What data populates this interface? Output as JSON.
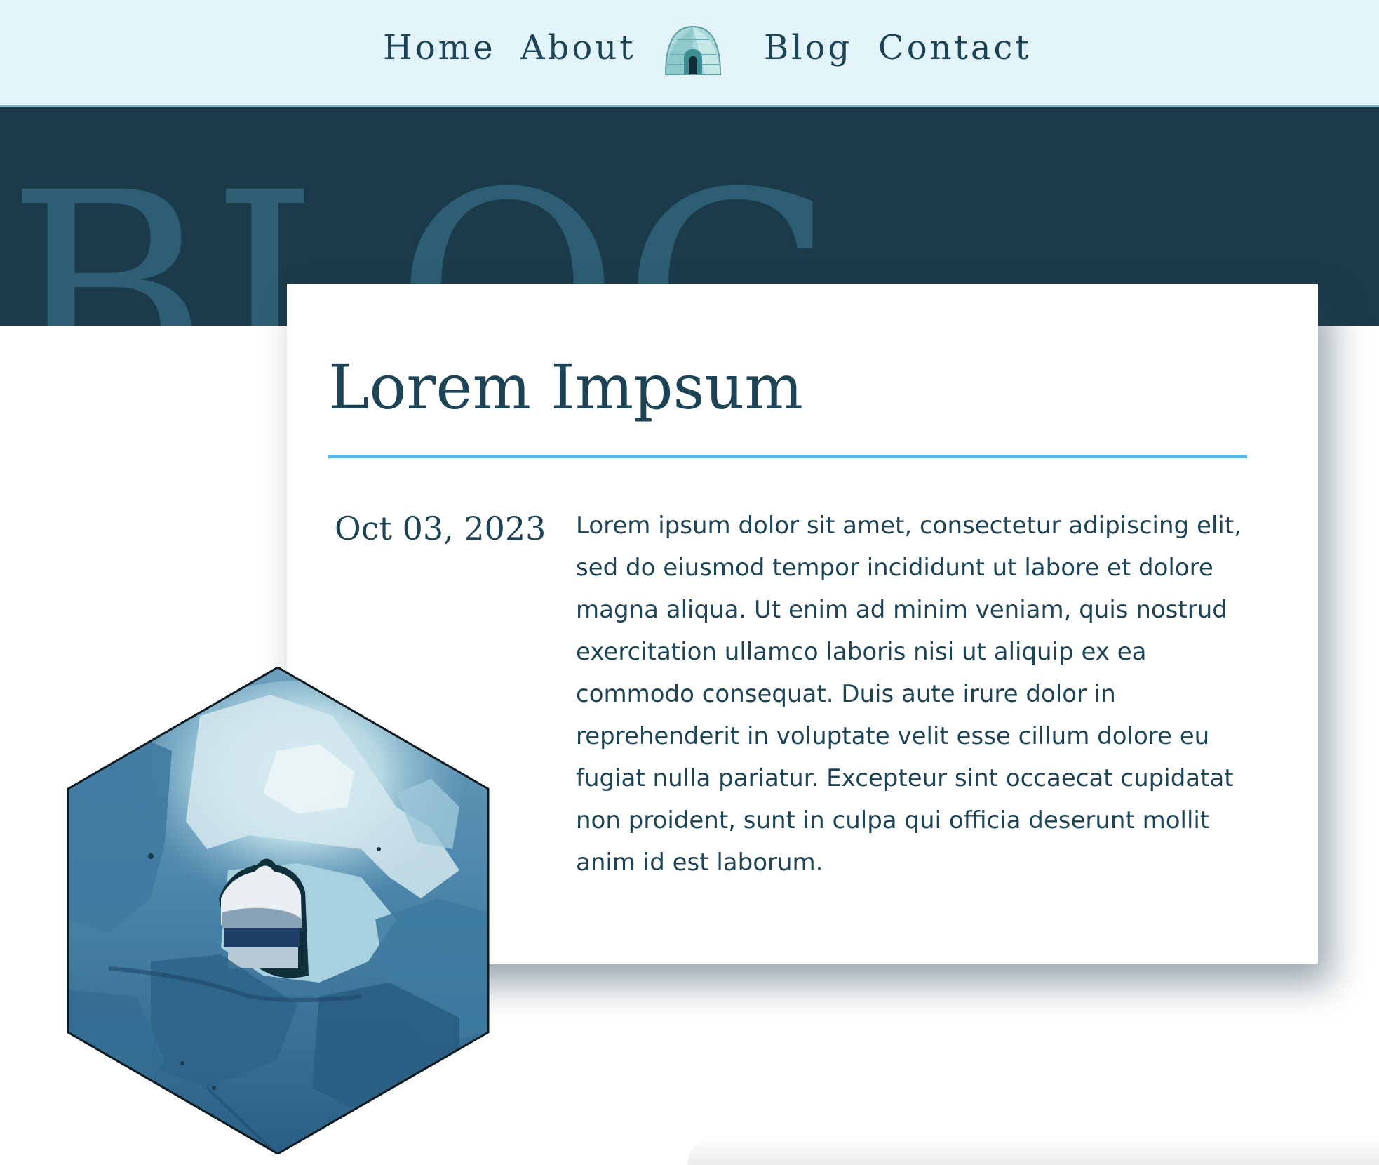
{
  "nav": {
    "items": [
      {
        "label": "Home"
      },
      {
        "label": "About"
      },
      {
        "label": "Blog"
      },
      {
        "label": "Contact"
      }
    ],
    "logo_icon": "igloo-icon"
  },
  "hero": {
    "title": "BLOG"
  },
  "post": {
    "title": "Lorem Impsum",
    "date": "Oct 03, 2023",
    "body": "Lorem ipsum dolor sit amet, consectetur adipiscing elit, sed do eiusmod tempor incididunt ut labore et dolore magna aliqua. Ut enim ad minim veniam, quis nostrud exercitation ullamco laboris nisi ut aliquip ex ea commodo consequat. Duis aute irure dolor in reprehenderit in voluptate velit esse cillum dolore eu fugiat nulla pariatur. Excepteur sint occaecat cupidatat non proident, sunt in culpa qui officia deserunt mollit anim id est laborum."
  },
  "image": {
    "shape": "hexagon"
  },
  "colors": {
    "nav_background": "#e2f4fa",
    "hero_background": "#1c3b4a",
    "hero_text": "#2d5e73",
    "accent": "#5bb7e3",
    "text": "#1d4356"
  }
}
